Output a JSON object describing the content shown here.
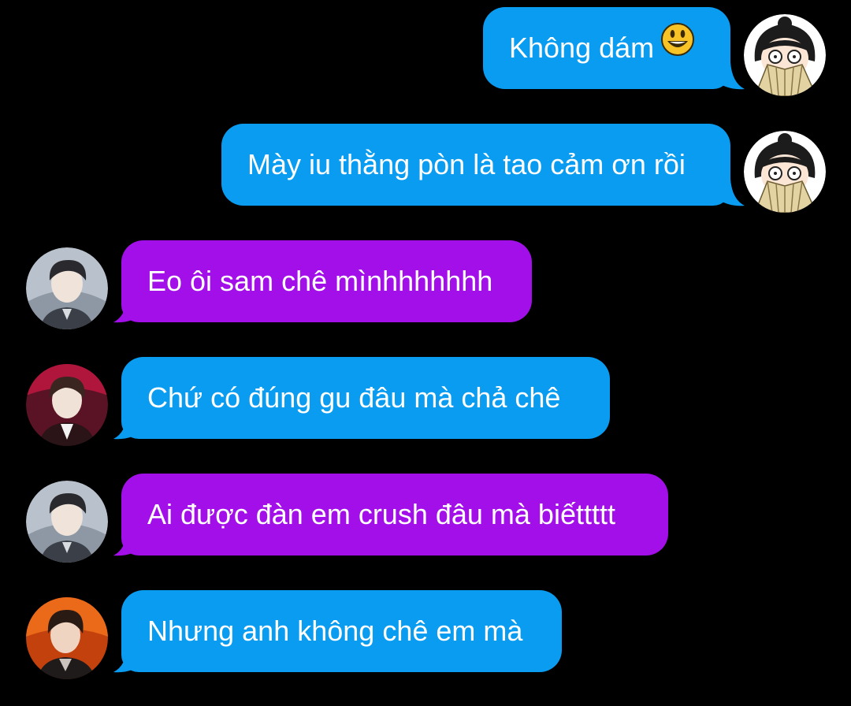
{
  "messages": [
    {
      "side": "out",
      "text": "Không dám",
      "emoji": "grinning-face-emoji",
      "color": "#0a9cf0",
      "avatar": "girl-fan-avatar"
    },
    {
      "side": "out",
      "text": "Mày iu thằng pòn là tao cảm ơn rồi",
      "color": "#0a9cf0",
      "avatar": "girl-fan-avatar"
    },
    {
      "side": "in",
      "text": "Eo ôi sam chê mìnhhhhhhh",
      "color": "#a20fe8",
      "avatar": "male-avatar-gray"
    },
    {
      "side": "in",
      "text": "Chứ có đúng gu đâu mà chả chê",
      "color": "#0a9cf0",
      "avatar": "male-avatar-red"
    },
    {
      "side": "in",
      "text": "Ai được đàn em crush đâu mà biếttttt",
      "color": "#a20fe8",
      "avatar": "male-avatar-gray"
    },
    {
      "side": "in",
      "text": "Nhưng anh không chê em mà",
      "color": "#0a9cf0",
      "avatar": "male-avatar-orange"
    }
  ],
  "colors": {
    "background": "#000000",
    "blue_bubble": "#0a9cf0",
    "purple_bubble": "#a20fe8"
  }
}
